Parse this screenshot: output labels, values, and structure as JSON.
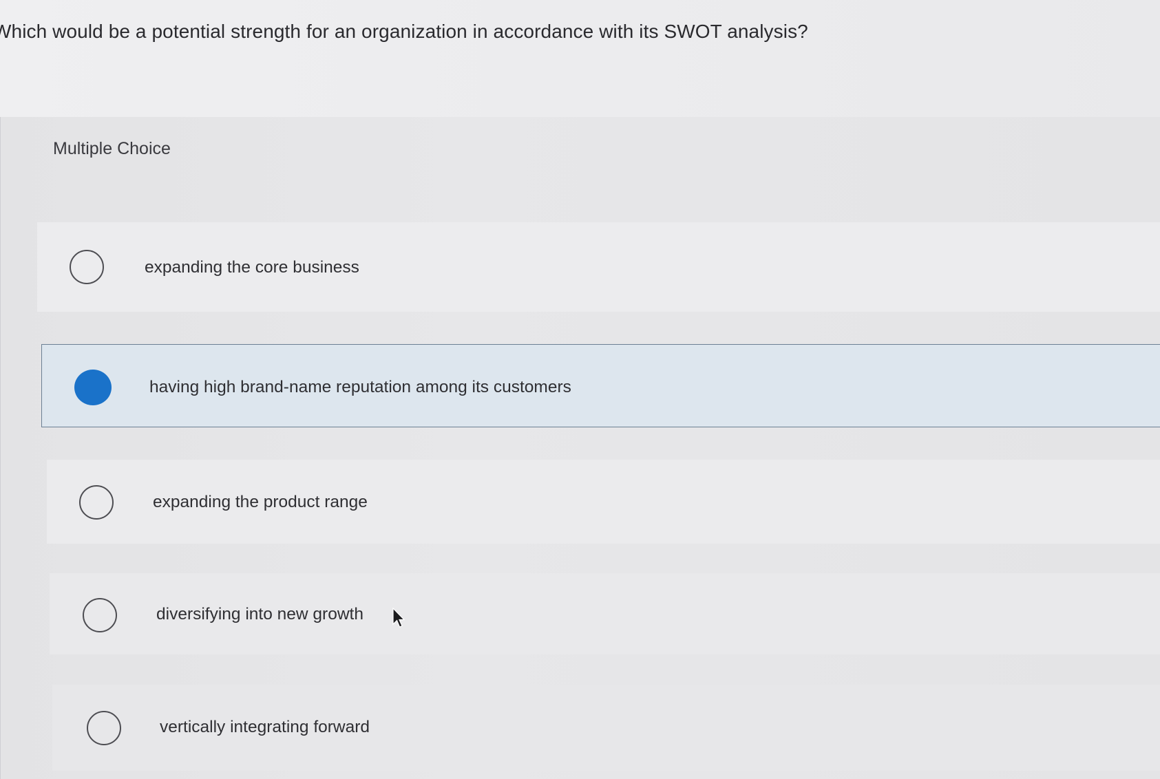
{
  "question": {
    "text": "Which would be a potential strength for an organization in accordance with its SWOT analysis?"
  },
  "answer_section": {
    "type_label": "Multiple Choice",
    "options": [
      {
        "label": "expanding the core business",
        "selected": false
      },
      {
        "label": "having high brand-name reputation among its customers",
        "selected": true
      },
      {
        "label": "expanding the product range",
        "selected": false
      },
      {
        "label": "diversifying into new growth",
        "selected": false
      },
      {
        "label": "vertically integrating forward",
        "selected": false
      }
    ]
  },
  "colors": {
    "selected_radio": "#1a72c9",
    "selected_option_bg": "#dde6ee",
    "selected_option_border": "#6b7f93"
  },
  "icons": {
    "cursor": "mouse-pointer-icon"
  }
}
